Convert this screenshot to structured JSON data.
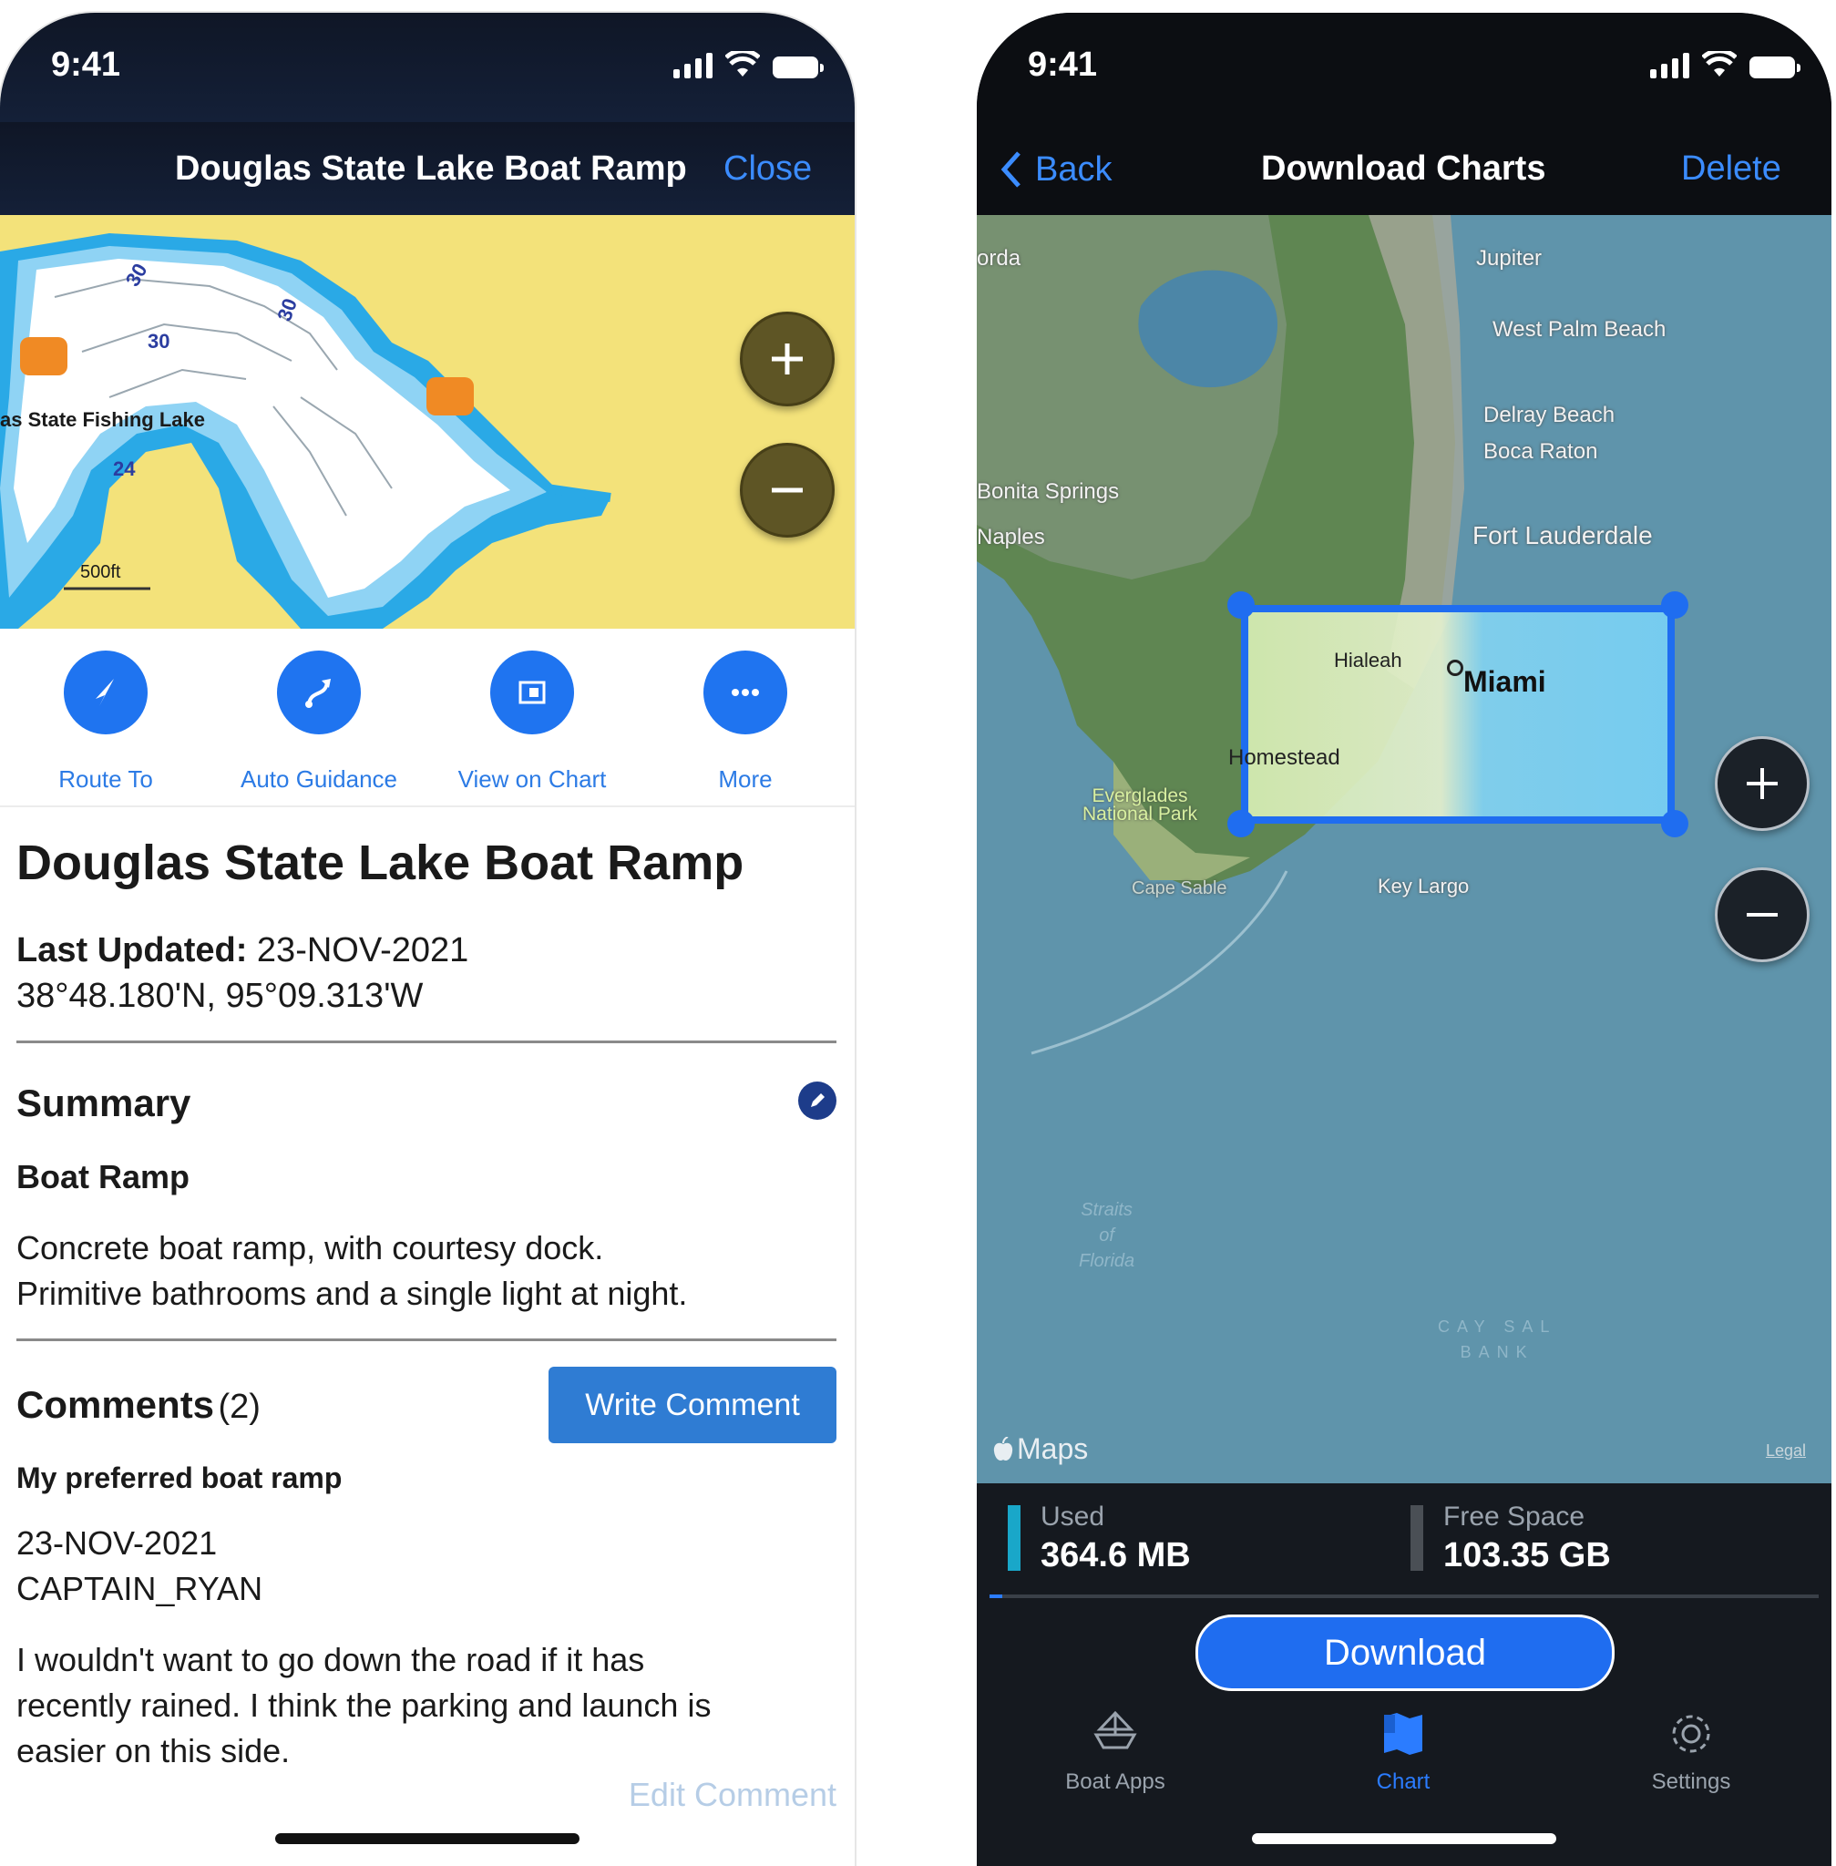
{
  "left": {
    "status_time": "9:41",
    "nav": {
      "title": "Douglas State Lake Boat Ramp",
      "close_label": "Close"
    },
    "map": {
      "lake_label": "as State Fishing Lake",
      "depths": [
        "30",
        "30",
        "30",
        "24"
      ],
      "scale": "500ft"
    },
    "actions": [
      {
        "label": "Route To",
        "icon": "route-arrow-icon"
      },
      {
        "label": "Auto Guidance",
        "icon": "auto-guidance-icon"
      },
      {
        "label": "View on Chart",
        "icon": "chart-icon"
      },
      {
        "label": "More",
        "icon": "more-dots-icon"
      }
    ],
    "poi": {
      "title": "Douglas State Lake Boat Ramp",
      "last_updated_label": "Last Updated:",
      "last_updated": "23-NOV-2021",
      "coordinates": "38°48.180'N, 95°09.313'W"
    },
    "summary": {
      "title": "Summary",
      "type": "Boat Ramp",
      "line1": "Concrete boat ramp, with courtesy dock.",
      "line2": "Primitive bathrooms and a single light at night."
    },
    "comments": {
      "title": "Comments",
      "count": "(2)",
      "write_label": "Write Comment",
      "first": {
        "title": "My preferred boat ramp",
        "date": "23-NOV-2021",
        "author": "CAPTAIN_RYAN",
        "line1": "I wouldn't want to go down the road if it has",
        "line2": "recently rained. I think the parking and launch is",
        "line3": "easier on this side.",
        "edit_label": "Edit Comment"
      }
    }
  },
  "right": {
    "status_time": "9:41",
    "nav": {
      "back_label": "Back",
      "title": "Download Charts",
      "delete_label": "Delete"
    },
    "map": {
      "labels": {
        "orda": "orda",
        "jupiter": "Jupiter",
        "west_palm": "West Palm Beach",
        "delray": "Delray Beach",
        "boca": "Boca Raton",
        "bonita": "Bonita Springs",
        "naples": "Naples",
        "fort_lauderdale": "Fort Lauderdale",
        "hialeah": "Hialeah",
        "miami": "Miami",
        "homestead": "Homestead",
        "everglades1": "Everglades",
        "everglades2": "National Park",
        "cape_sable": "Cape Sable",
        "key_largo": "Key Largo",
        "straits1": "Straits",
        "straits2": "of",
        "straits3": "Florida",
        "cay_sal1": "CAY SAL",
        "cay_sal2": "BANK"
      },
      "maps_logo": "Maps",
      "legal": "Legal"
    },
    "storage": {
      "used_label": "Used",
      "used_value": "364.6 MB",
      "free_label": "Free Space",
      "free_value": "103.35 GB",
      "used_fraction": 0.004
    },
    "download_label": "Download",
    "tabs": [
      {
        "label": "Boat Apps",
        "icon": "boat-apps-icon"
      },
      {
        "label": "Chart",
        "icon": "chart-tab-icon"
      },
      {
        "label": "Settings",
        "icon": "settings-gear-icon"
      }
    ],
    "colors": {
      "accent": "#1f6df0",
      "used_bar": "#19a7c9",
      "free_bar": "#4a4f55"
    }
  }
}
